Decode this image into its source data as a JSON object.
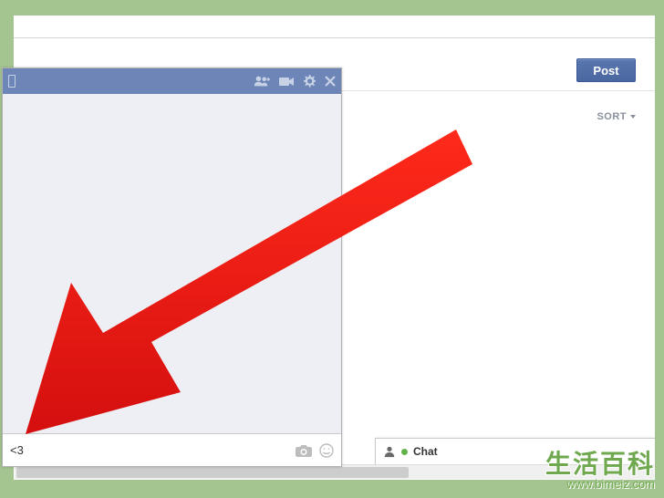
{
  "post_button_label": "Post",
  "sort": {
    "label": "SORT"
  },
  "chat_input": {
    "value": "<3"
  },
  "chat_tab": {
    "label": "Chat"
  },
  "watermark": {
    "title": "生活百科",
    "url": "www.bimeiz.com"
  }
}
